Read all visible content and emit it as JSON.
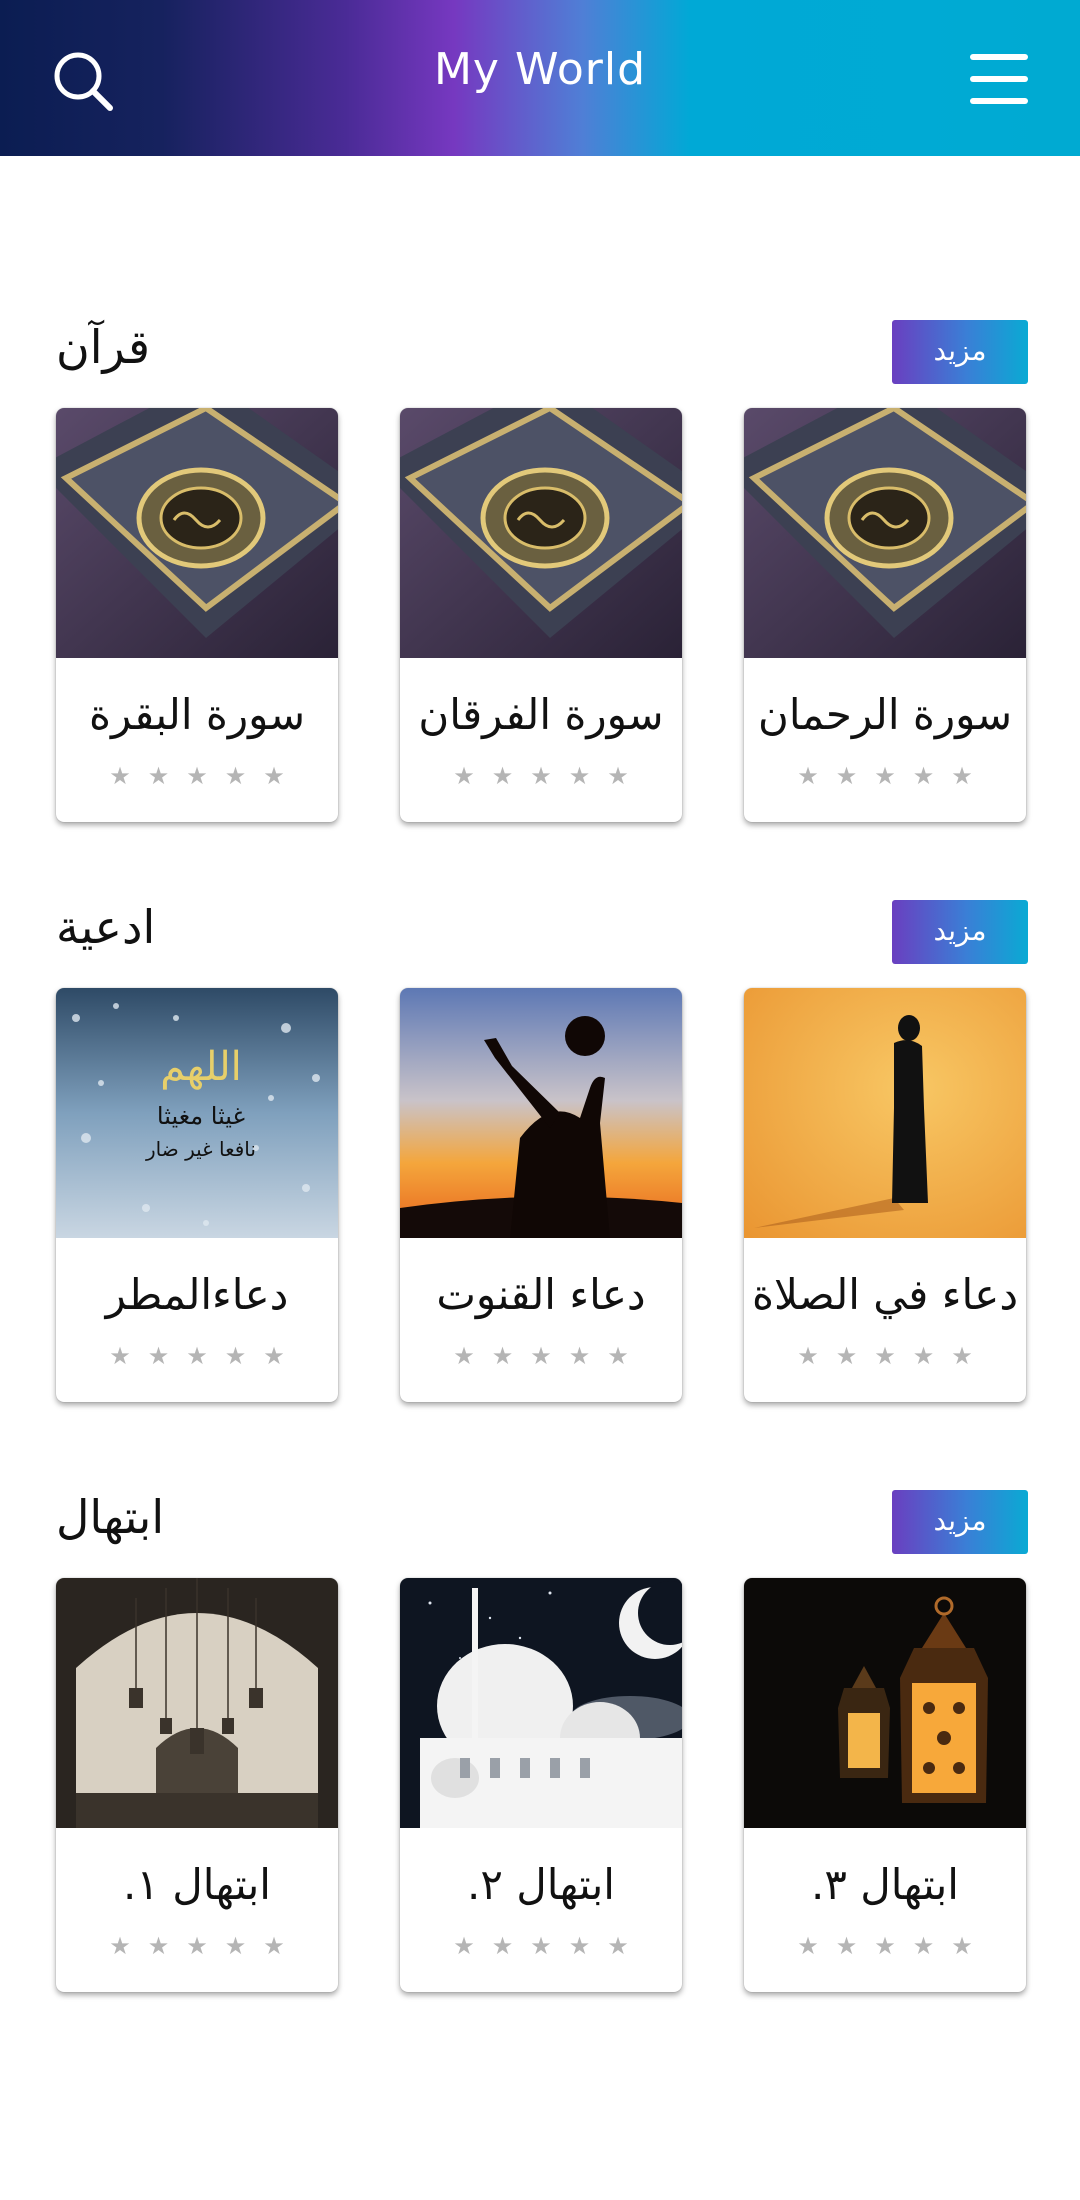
{
  "header": {
    "title": "My World",
    "search_icon": "search-icon",
    "menu_icon": "hamburger-menu-icon",
    "gradient": [
      "#0b1d52",
      "#7638c0",
      "#00a9d6"
    ]
  },
  "sections": [
    {
      "title": "قرآن",
      "more_label": "مزيد",
      "cards": [
        {
          "label": "سورة البقرة",
          "stars": "★★★★★"
        },
        {
          "label": "سورة الفرقان",
          "stars": "★★★★★"
        },
        {
          "label": "سورة الرحمان",
          "stars": "★★★★★"
        }
      ]
    },
    {
      "title": "ادعية",
      "more_label": "مزيد",
      "cards": [
        {
          "label": "دعاءالمطر",
          "stars": "★★★★★",
          "image_text": [
            "اللهم",
            "غيثا مغيثا",
            "نافعا غير ضار"
          ]
        },
        {
          "label": "دعاء القنوت",
          "stars": "★★★★★"
        },
        {
          "label": "دعاء في الصلاة",
          "stars": "★★★★★"
        }
      ]
    },
    {
      "title": "ابتهال",
      "more_label": "مزيد",
      "cards": [
        {
          "label": "ابتهال ١.",
          "stars": "★★★★★"
        },
        {
          "label": "ابتهال ٢.",
          "stars": "★★★★★"
        },
        {
          "label": "ابتهال ٣.",
          "stars": "★★★★★"
        }
      ]
    }
  ],
  "colors": {
    "star": "#b5b5b5",
    "more_button_gradient": [
      "#6a3fc0",
      "#0aaad4"
    ]
  }
}
